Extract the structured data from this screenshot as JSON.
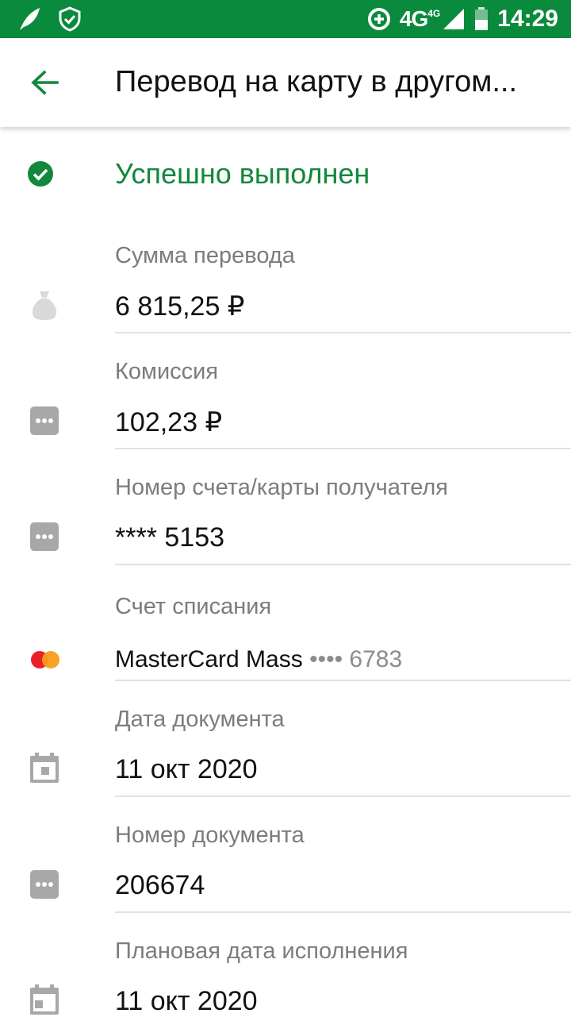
{
  "status_bar": {
    "network": "4G",
    "network_sub": "4G",
    "time": "14:29",
    "icons": [
      "leaf-icon",
      "shield-check-icon",
      "data-saver-icon",
      "signal-icon",
      "battery-icon"
    ]
  },
  "header": {
    "title": "Перевод на карту в другом...",
    "back_icon": "arrow-left-icon"
  },
  "status": {
    "text": "Успешно выполнен",
    "icon": "check-circle-icon",
    "color": "#11883b"
  },
  "details": [
    {
      "label": "Сумма перевода",
      "value": "6 815,25 ₽",
      "icon": "money-bag-icon"
    },
    {
      "label": "Комиссия",
      "value": "102,23 ₽",
      "icon": "more-dots-icon"
    },
    {
      "label": "Номер счета/карты получателя",
      "value": "**** 5153",
      "icon": "more-dots-icon"
    },
    {
      "label": "Счет списания",
      "value": "MasterCard Mass",
      "value_masked": "•••• 6783",
      "icon": "mastercard-icon"
    },
    {
      "label": "Дата документа",
      "value": "11 окт 2020",
      "icon": "calendar-icon"
    },
    {
      "label": "Номер документа",
      "value": "206674",
      "icon": "more-dots-icon"
    },
    {
      "label": "Плановая дата исполнения",
      "value": "11 окт 2020",
      "icon": "calendar-icon"
    }
  ],
  "colors": {
    "status_bar": "#0a8a3c",
    "accent": "#11883b",
    "icon_gray": "#a8a8a8",
    "mastercard_red": "#e8202a",
    "mastercard_orange": "#f79e1b"
  }
}
